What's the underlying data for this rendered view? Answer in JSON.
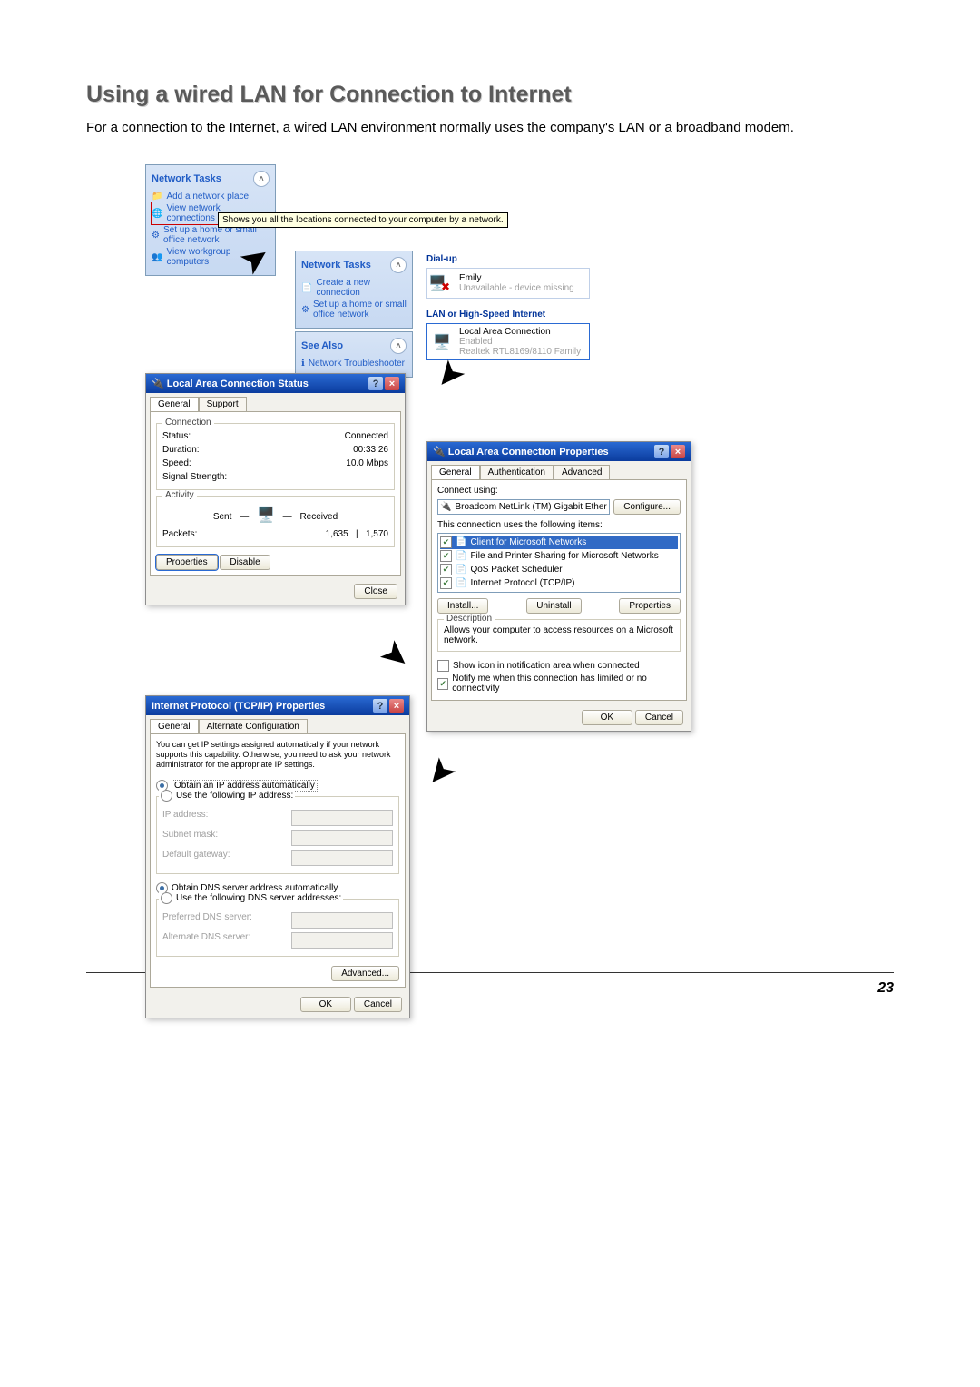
{
  "doc": {
    "title": "Using a wired LAN for Connection to Internet",
    "intro": "For a connection to the Internet, a wired LAN environment normally uses the company's LAN or a broadband modem.",
    "page_number": "23"
  },
  "sidebar1": {
    "heading": "Network Tasks",
    "items": {
      "add_place": "Add a network place",
      "view_conn": "View network connections",
      "setup_home": "Set up a home or small office network",
      "tooltip": "Shows you all the locations connected to your computer by a network.",
      "view_workgroup": "View workgroup computers"
    }
  },
  "sidebar2": {
    "heading": "Network Tasks",
    "items": {
      "create": "Create a new connection",
      "setup_home": "Set up a home or small office network"
    },
    "see_also_heading": "See Also",
    "see_also_item": "Network Troubleshooter"
  },
  "netlist": {
    "dialup_heading": "Dial-up",
    "dialup_name": "Emily",
    "dialup_status": "Unavailable - device missing",
    "lan_heading": "LAN or High-Speed Internet",
    "lan_name": "Local Area Connection",
    "lan_status": "Enabled",
    "lan_device": "Realtek RTL8169/8110 Family"
  },
  "status_dlg": {
    "title": "Local Area Connection Status",
    "tabs": {
      "general": "General",
      "support": "Support"
    },
    "connection_group": "Connection",
    "status_label": "Status:",
    "status_value": "Connected",
    "duration_label": "Duration:",
    "duration_value": "00:33:26",
    "speed_label": "Speed:",
    "speed_value": "10.0 Mbps",
    "signal_label": "Signal Strength:",
    "activity_group": "Activity",
    "sent_label": "Sent",
    "received_label": "Received",
    "packets_label": "Packets:",
    "packets_sent": "1,635",
    "packets_received": "1,570",
    "btn_properties": "Properties",
    "btn_disable": "Disable",
    "btn_close": "Close"
  },
  "props_dlg": {
    "title": "Local Area Connection Properties",
    "tabs": {
      "general": "General",
      "auth": "Authentication",
      "adv": "Advanced"
    },
    "connect_using_label": "Connect using:",
    "adapter": "Broadcom NetLink (TM) Gigabit Ether",
    "btn_configure": "Configure...",
    "uses_items_label": "This connection uses the following items:",
    "items": {
      "client": "Client for Microsoft Networks",
      "fileprint": "File and Printer Sharing for Microsoft Networks",
      "qos": "QoS Packet Scheduler",
      "tcpip": "Internet Protocol (TCP/IP)"
    },
    "btn_install": "Install...",
    "btn_uninstall": "Uninstall",
    "btn_properties": "Properties",
    "desc_group": "Description",
    "desc_text": "Allows your computer to access resources on a Microsoft network.",
    "show_icon": "Show icon in notification area when connected",
    "notify": "Notify me when this connection has limited or no connectivity",
    "btn_ok": "OK",
    "btn_cancel": "Cancel"
  },
  "tcpip_dlg": {
    "title": "Internet Protocol (TCP/IP) Properties",
    "tabs": {
      "general": "General",
      "alt": "Alternate Configuration"
    },
    "desc": "You can get IP settings assigned automatically if your network supports this capability. Otherwise, you need to ask your network administrator for the appropriate IP settings.",
    "obtain_ip": "Obtain an IP address automatically",
    "use_ip": "Use the following IP address:",
    "ip_addr": "IP address:",
    "subnet": "Subnet mask:",
    "gateway": "Default gateway:",
    "obtain_dns": "Obtain DNS server address automatically",
    "use_dns": "Use the following DNS server addresses:",
    "pref_dns": "Preferred DNS server:",
    "alt_dns": "Alternate DNS server:",
    "btn_adv": "Advanced...",
    "btn_ok": "OK",
    "btn_cancel": "Cancel"
  }
}
